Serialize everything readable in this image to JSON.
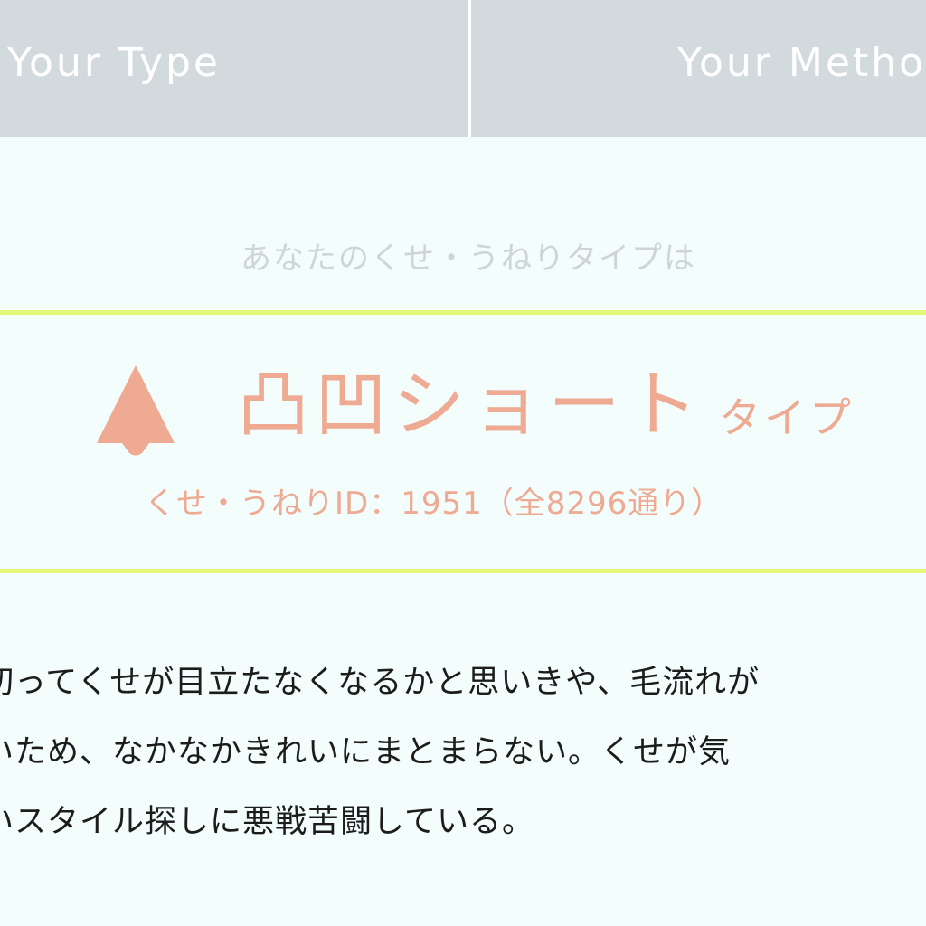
{
  "tabs": {
    "type_label": "Your Type",
    "method_label": "Your Metho"
  },
  "prompt": "あなたのくせ・うねりタイプは",
  "result": {
    "icon": "triangle-icon",
    "type_name": "凸凹ショート",
    "type_suffix": "タイプ",
    "id_text": "くせ・うねりID：1951（全8296通り）"
  },
  "description": {
    "lines": [
      "切ってくせが目立たなくなるかと思いきや、毛流れが",
      "いため、なかなかきれいにまとまらない。くせが気",
      "いスタイル探しに悪戦苦闘している。"
    ]
  },
  "colors": {
    "tab_bg": "#d2dade",
    "accent": "#eeaa92",
    "rule": "#e3f779",
    "background": "#f2fdfc"
  }
}
